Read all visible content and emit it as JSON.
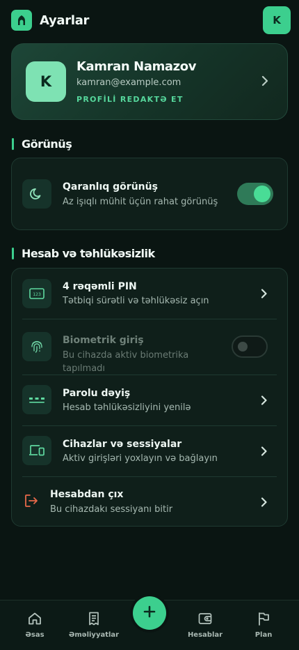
{
  "header": {
    "title": "Ayarlar",
    "avatar_initial": "K",
    "logo_icon": "mosque-icon"
  },
  "profile": {
    "initial": "K",
    "name": "Kamran Namazov",
    "email": "kamran@example.com",
    "edit_label": "PROFİLİ REDAKTƏ ET"
  },
  "appearance": {
    "section_title": "Görünüş",
    "dark_mode": {
      "title": "Qaranlıq görünüş",
      "subtitle": "Az işıqlı mühit üçün rahat görünüş",
      "enabled": true,
      "icon": "moon-icon"
    }
  },
  "security": {
    "section_title": "Hesab və təhlükəsizlik",
    "items": [
      {
        "title": "4 rəqəmli PIN",
        "subtitle": "Tətbiqi sürətli və təhlükəsiz açın",
        "icon": "pin-keypad-icon"
      },
      {
        "title": "Biometrik giriş",
        "subtitle": "Bu cihazda aktiv biometrika tapılmadı",
        "icon": "fingerprint-icon",
        "enabled": false,
        "disabled": true
      },
      {
        "title": "Parolu dəyiş",
        "subtitle": "Hesab təhlükəsizliyini yenilə",
        "icon": "password-icon"
      },
      {
        "title": "Cihazlar və sessiyalar",
        "subtitle": "Aktiv girişləri yoxlayın və bağlayın",
        "icon": "devices-icon"
      },
      {
        "title": "Hesabdan çıx",
        "subtitle": "Bu cihazdakı sessiyanı bitir",
        "icon": "logout-icon"
      }
    ]
  },
  "nav": {
    "items": [
      {
        "label": "Əsas",
        "icon": "home-icon"
      },
      {
        "label": "Əməliyyatlar",
        "icon": "receipt-icon"
      },
      {
        "label": "Hesablar",
        "icon": "wallet-icon"
      },
      {
        "label": "Plan",
        "icon": "flag-icon"
      }
    ],
    "fab_icon": "plus-icon"
  },
  "colors": {
    "accent": "#3ccf8e",
    "background": "#0a1512",
    "card": "#0f1f1a",
    "danger": "#e8694a"
  }
}
